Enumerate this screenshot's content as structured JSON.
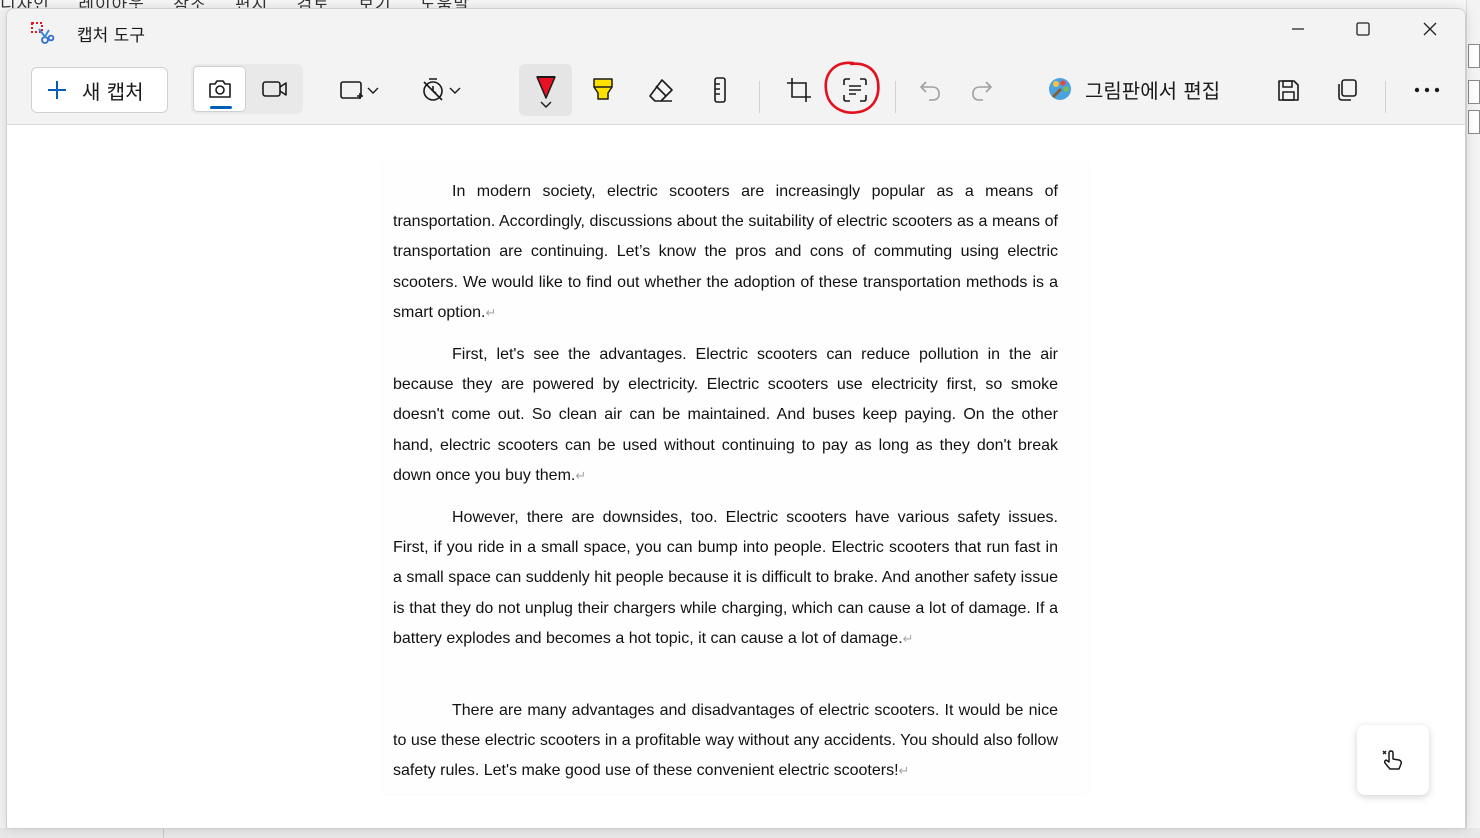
{
  "background_app": {
    "menu": [
      "디자인",
      "레이아웃",
      "참조",
      "편지",
      "검토",
      "보기",
      "도움말"
    ]
  },
  "window": {
    "title": "캡처 도구",
    "controls": {
      "minimize": "minimize-icon",
      "maximize": "maximize-icon",
      "close": "close-icon"
    }
  },
  "toolbar": {
    "new_capture_label": "새 캡처",
    "modes": [
      {
        "icon": "camera-icon",
        "selected": true
      },
      {
        "icon": "video-camera-icon",
        "selected": false
      }
    ],
    "shape_icon": "rectangle-snip-icon",
    "timer_icon": "no-delay-timer-icon",
    "tools": [
      "ballpoint-pen-icon",
      "highlighter-icon",
      "eraser-icon",
      "ruler-icon",
      "crop-icon",
      "text-actions-icon",
      "undo-icon",
      "redo-icon"
    ],
    "edit_in_paint_label": "그림판에서 편집",
    "save_icon": "save-icon",
    "copy_icon": "copy-icon",
    "more_icon": "more-options-icon",
    "colors": {
      "accent": "#005fb8",
      "pen_red": "#e81123",
      "highlighter_yellow": "#ffe100",
      "annotation_red": "#e3101e"
    }
  },
  "document": {
    "paragraphs": [
      "In modern society, electric scooters are increasingly popular as a means of transportation. Accordingly, discussions about the suitability of electric scooters as a means of transportation are continuing. Let’s know the pros and cons of commuting using electric scooters. We would like to find out whether the adoption of these transportation methods is a smart option.",
      "First, let's see the advantages.  Electric scooters can reduce pollution in the air because they are powered by electricity. Electric scooters use electricity first, so smoke doesn't come out. So clean air can be maintained. And buses keep paying. On the other hand, electric scooters can be used without continuing to pay as long as they don't break down once you buy them.",
      "However, there are downsides, too. Electric scooters have various safety issues. First, if you ride in a small space, you can bump into people. Electric scooters that run fast in a small space can suddenly hit people because it is difficult to brake. And another safety issue is that they do not unplug their chargers while charging, which can cause a lot of damage. If a battery explodes and becomes a hot topic, it can cause a lot of damage.",
      "There are many advantages and disadvantages of electric scooters. It would be nice to use these electric scooters in a profitable way without any accidents. You should also follow safety rules. Let's make good use of these convenient electric scooters!"
    ],
    "paragraph_mark": "↵"
  },
  "touch_writing_icon": "touch-writing-icon"
}
